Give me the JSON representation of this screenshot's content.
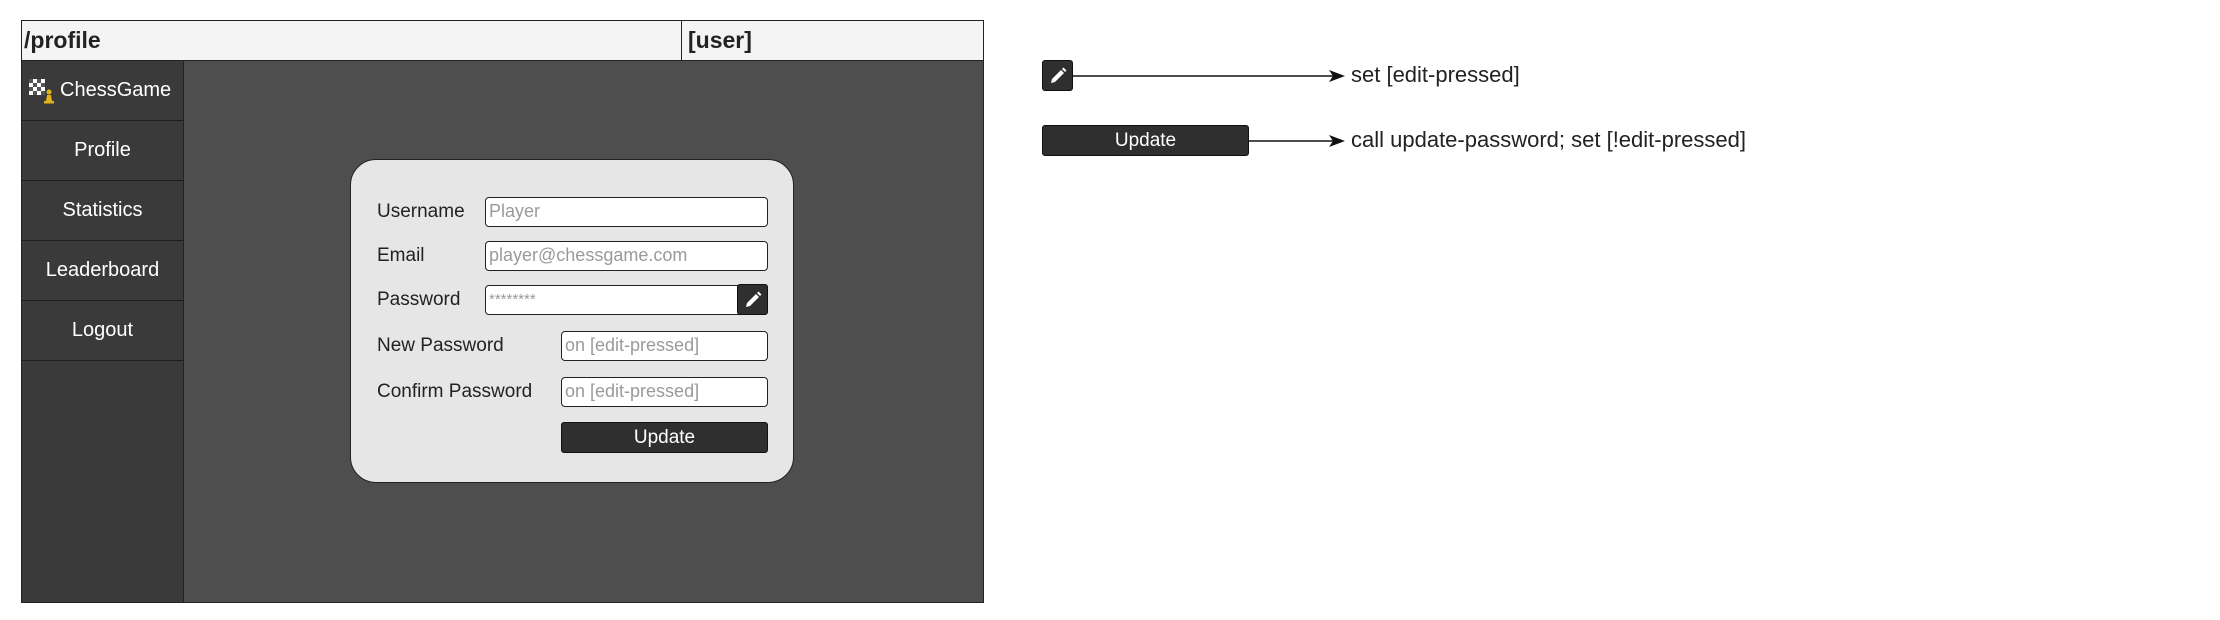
{
  "route": "/profile",
  "user_label": "[user]",
  "sidebar": {
    "brand": "ChessGame",
    "items": [
      {
        "label": "Profile"
      },
      {
        "label": "Statistics"
      },
      {
        "label": "Leaderboard"
      },
      {
        "label": "Logout"
      }
    ]
  },
  "form": {
    "username_label": "Username",
    "username_value": "Player",
    "email_label": "Email",
    "email_value": "player@chessgame.com",
    "password_label": "Password",
    "password_value": "********",
    "new_password_label": "New Password",
    "new_password_value": "on [edit-pressed]",
    "confirm_password_label": "Confirm Password",
    "confirm_password_value": "on [edit-pressed]",
    "update_label": "Update"
  },
  "annotations": {
    "edit_action": "set [edit-pressed]",
    "update_button_label": "Update",
    "update_action": "call update-password; set [!edit-pressed]"
  },
  "icons": {
    "edit": "pencil-icon",
    "logo": "chess-logo-icon"
  }
}
